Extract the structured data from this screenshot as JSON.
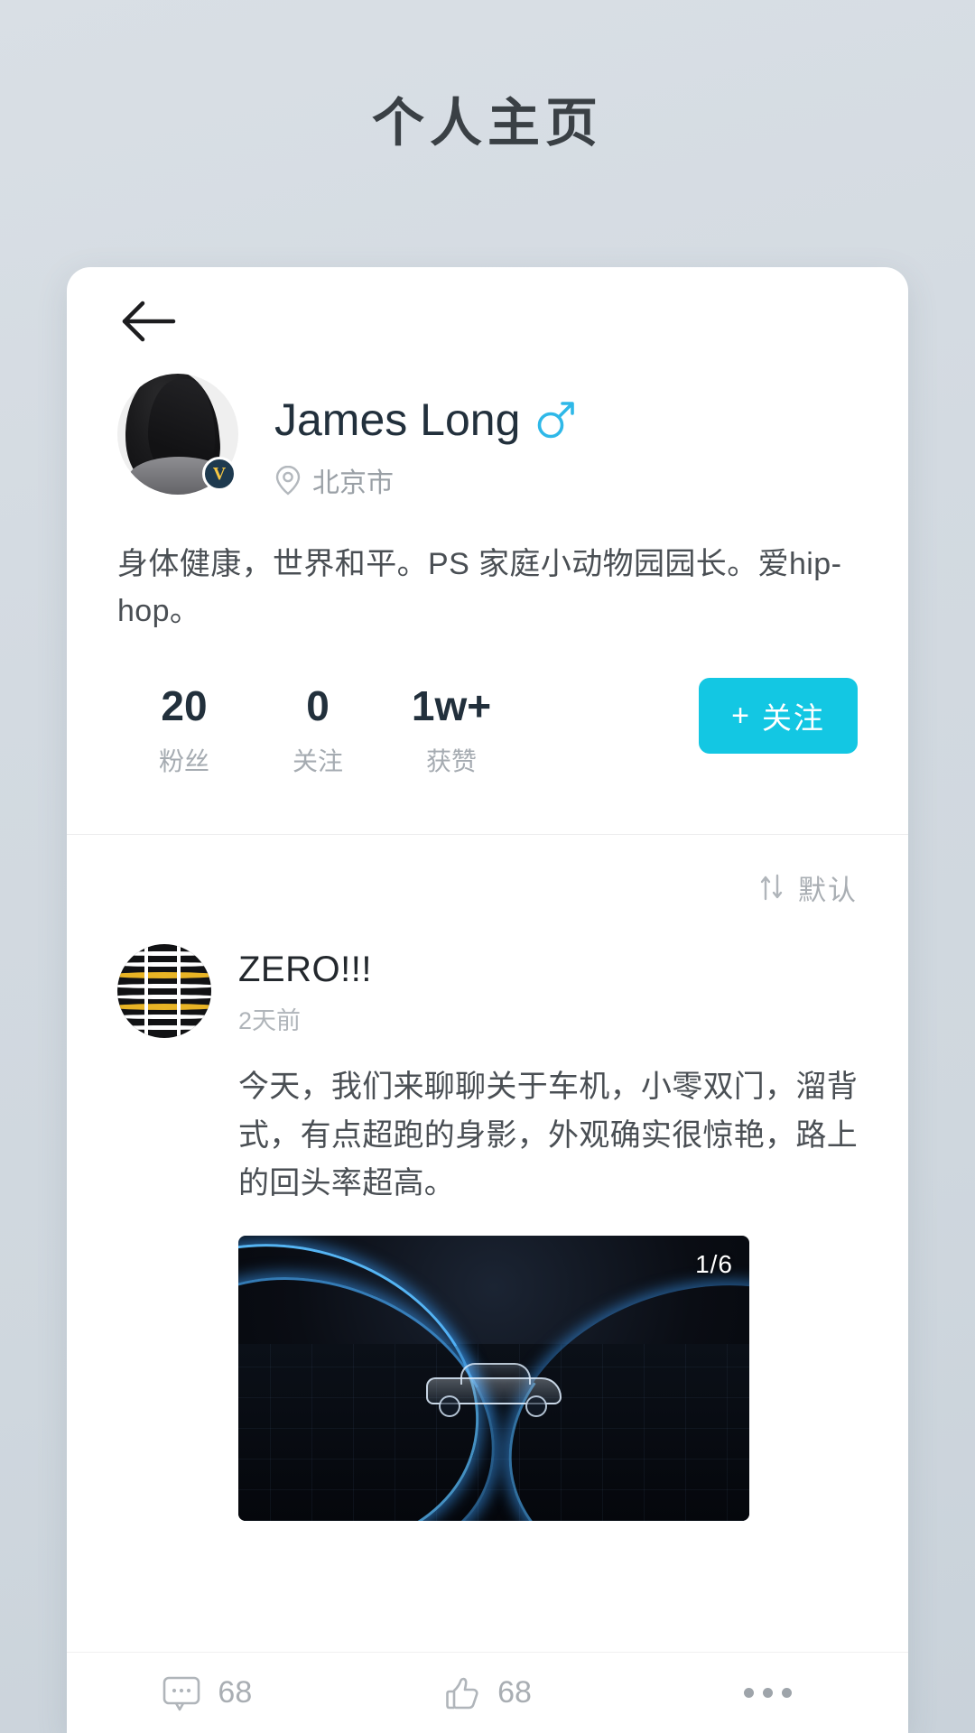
{
  "header": {
    "title": "个人主页"
  },
  "nav": {
    "back_icon": "arrow-left-icon"
  },
  "profile": {
    "avatar_alt": "user-avatar",
    "verified_mark": "V",
    "display_name": "James Long",
    "gender_icon": "male-icon",
    "location_icon": "location-pin-icon",
    "location": "北京市",
    "bio": "身体健康，世界和平。PS 家庭小动物园园长。爱hip-hop。",
    "stats": [
      {
        "value": "20",
        "label": "粉丝"
      },
      {
        "value": "0",
        "label": "关注"
      },
      {
        "value": "1w+",
        "label": "获赞"
      }
    ],
    "follow_button": {
      "plus": "+",
      "label": "关注"
    }
  },
  "sort": {
    "icon": "sort-updown-icon",
    "label": "默认"
  },
  "post": {
    "author": "ZERO!!!",
    "author_avatar_alt": "post-author-avatar",
    "time": "2天前",
    "body": "今天，我们来聊聊关于车机，小零双门，溜背式，有点超跑的身影，外观确实很惊艳，路上的回头率超高。",
    "media": {
      "alt": "car-light-trail-image",
      "counter": "1/6"
    },
    "actions": {
      "comment_icon": "comment-bubble-icon",
      "comment_count": "68",
      "like_icon": "thumbs-up-icon",
      "like_count": "68",
      "more_icon": "more-dots-icon"
    }
  },
  "colors": {
    "accent": "#13c7e3",
    "gender": "#2fb8e8",
    "name": "#22303c",
    "muted": "#a5abb1"
  }
}
